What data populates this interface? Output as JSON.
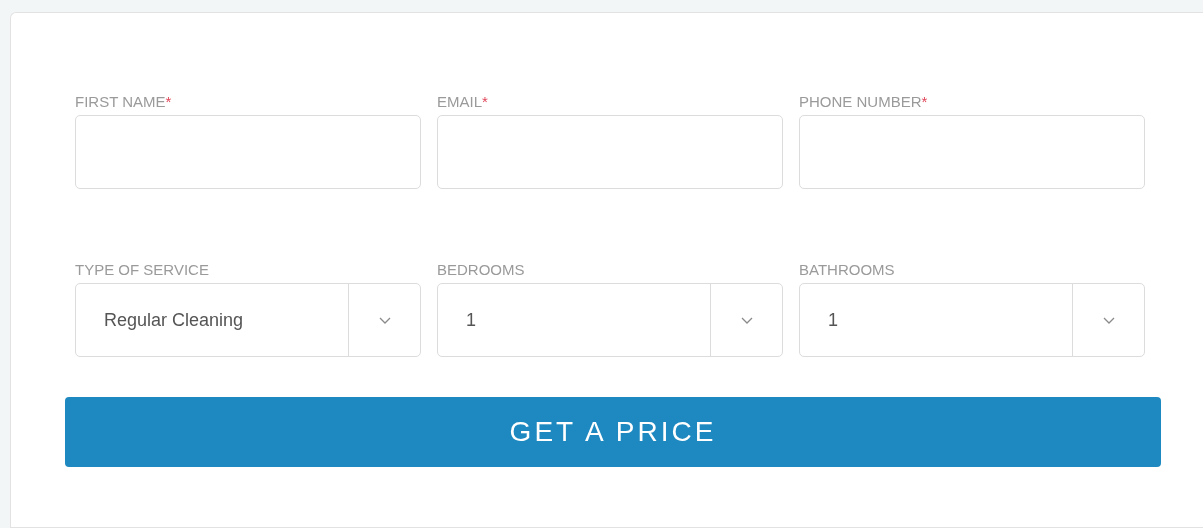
{
  "contact_fields": [
    {
      "label": "FIRST NAME",
      "required_mark": "*"
    },
    {
      "label": "EMAIL",
      "required_mark": "*"
    },
    {
      "label": "PHONE NUMBER",
      "required_mark": "*"
    }
  ],
  "select_fields": [
    {
      "label": "TYPE OF SERVICE",
      "value": "Regular Cleaning"
    },
    {
      "label": "BEDROOMS",
      "value": "1"
    },
    {
      "label": "BATHROOMS",
      "value": "1"
    }
  ],
  "submit_button": "GET A PRICE"
}
